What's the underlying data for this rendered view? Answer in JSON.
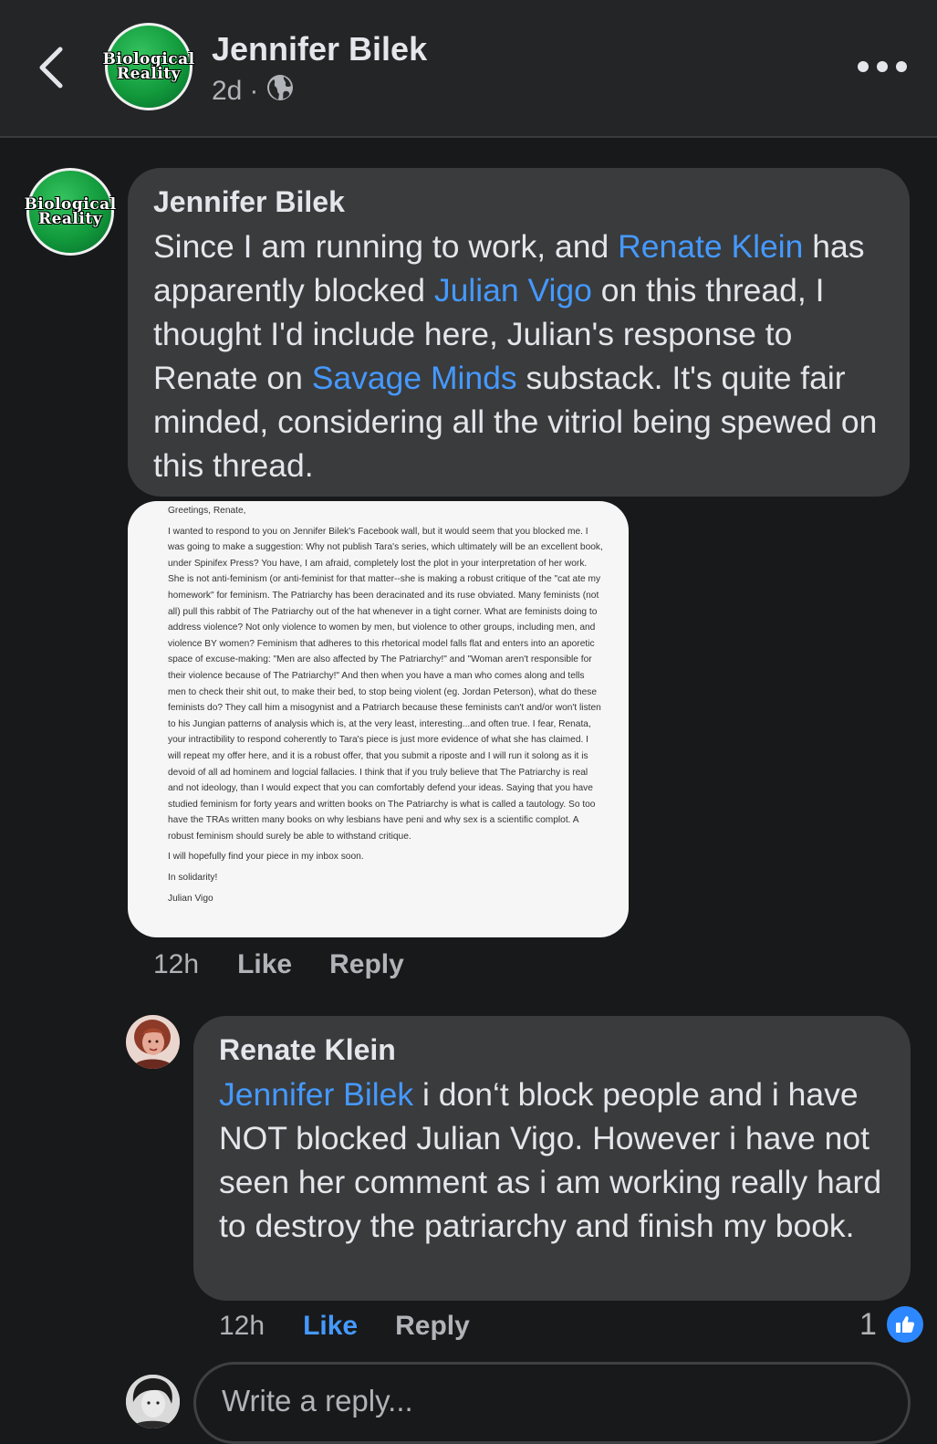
{
  "header": {
    "page_name": "Jennifer Bilek",
    "time": "2d",
    "separator": "·",
    "logo_line1": "Biological",
    "logo_line2": "Reality"
  },
  "comment1": {
    "author": "Jennifer Bilek",
    "avatar_line1": "Biological",
    "avatar_line2": "Reality",
    "seg1": "Since I am running to work, and ",
    "link1": "Renate Klein",
    "seg2": " has apparently blocked ",
    "link2": "Julian Vigo",
    "seg3": " on this thread, I thought I'd include here, Julian's response to Renate on ",
    "link3": "Savage Minds",
    "seg4": " substack. It's quite fair minded, considering all the vitriol being spewed on this thread.",
    "attachment": {
      "greeting": "Greetings, Renate,",
      "body": "I wanted to respond to you on Jennifer Bilek's Facebook wall, but it would seem that you blocked me. I was going to make a suggestion: Why not publish Tara's series, which ultimately will be an excellent book, under Spinifex Press? You have, I am afraid, completely lost the plot in your interpretation of her work. She is not anti-feminism (or anti-feminist for that matter--she is making a robust critique of the \"cat ate my homework\" for feminism. The Patriarchy has been deracinated and its ruse obviated. Many feminists (not all) pull this rabbit of The Patriarchy out of the hat whenever in a tight corner. What are feminists doing to address violence? Not only violence to women by men, but violence to other groups, including men, and violence BY women? Feminism that adheres to this rhetorical model falls flat and enters into an aporetic space of excuse-making: \"Men are also affected by The Patriarchy!\" and \"Woman aren't responsible for their violence because of The Patriarchy!\" And then when you have a man who comes along and tells men to check their shit out, to make their bed, to stop being violent (eg. Jordan Peterson), what do these feminists do? They call him a misogynist and a Patriarch because these feminists can't and/or won't listen to his Jungian patterns of analysis which is, at the very least, interesting...and often true. I fear, Renata, your intractibility to respond coherently to Tara's piece is just more evidence of what she has claimed. I will repeat my offer here, and it is a robust offer, that you submit a riposte and I will run it solong as it is devoid of all ad hominem and logcial fallacies. I think that if you truly believe that The Patriarchy is real and not ideology, than I would expect that you can comfortably defend your ideas. Saying that you have studied feminism for forty years and written books on The Patriarchy is what is called a tautology. So too have the TRAs written many books on why lesbians have peni and why sex is a scientific complot. A robust feminism should surely be able to withstand critique.",
      "closing1": "I will hopefully find your piece in my inbox soon.",
      "closing2": "In solidarity!",
      "signature": "Julian Vigo"
    },
    "time": "12h",
    "like_label": "Like",
    "reply_label": "Reply"
  },
  "comment2": {
    "author": "Renate Klein",
    "mention": "Jennifer Bilek",
    "text": " i don‘t block people and i have NOT blocked Julian Vigo. However i have not seen her comment as i am working really hard to destroy the patriarchy and finish my book.",
    "time": "12h",
    "like_label": "Like",
    "reply_label": "Reply",
    "reaction_count": "1"
  },
  "reply_input": {
    "placeholder": "Write a reply..."
  },
  "colors": {
    "background": "#18191a",
    "bubble": "#3a3b3c",
    "link": "#4599ff",
    "like_blue": "#2d88ff"
  }
}
